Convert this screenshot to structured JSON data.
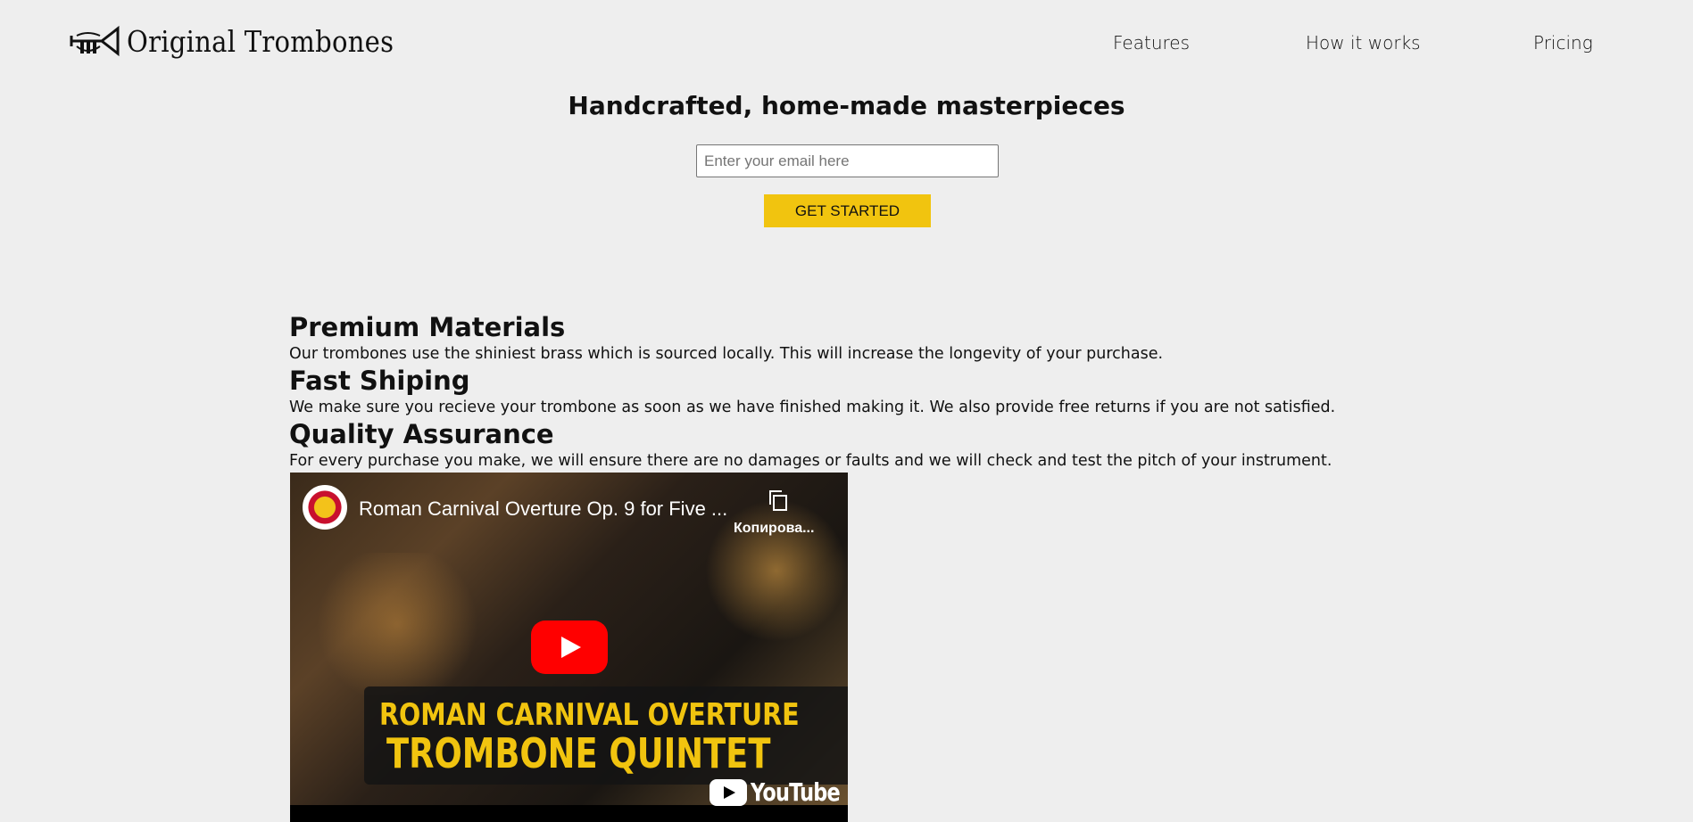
{
  "brand": {
    "name": "Original Trombones",
    "logo_icon": "trumpet-icon"
  },
  "nav": {
    "items": [
      "Features",
      "How it works",
      "Pricing"
    ]
  },
  "hero": {
    "title": "Handcrafted, home-made masterpieces",
    "email_placeholder": "Enter your email here",
    "cta_label": "GET STARTED",
    "cta_color": "#f1c40f"
  },
  "features": [
    {
      "title": "Premium Materials",
      "text": "Our trombones use the shiniest brass which is sourced locally. This will increase the longevity of your purchase."
    },
    {
      "title": "Fast Shiping",
      "text": "We make sure you recieve your trombone as soon as we have finished making it. We also provide free returns if you are not satisfied."
    },
    {
      "title": "Quality Assurance",
      "text": "For every purchase you make, we will ensure there are no damages or faults and we will check and test the pitch of your instrument."
    }
  ],
  "video": {
    "title": "Roman Carnival Overture Op. 9 for Five ...",
    "copy_label": "Копирова...",
    "caption_line1": "ROMAN CARNIVAL OVERTURE",
    "caption_line2": "TROMBONE QUINTET",
    "brand_text": "YouTube",
    "play_icon": "play-icon",
    "copy_icon": "copy-icon"
  }
}
